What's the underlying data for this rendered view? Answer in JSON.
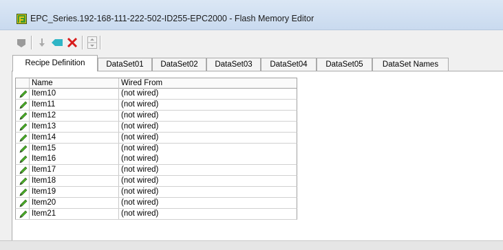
{
  "window": {
    "title": "EPC_Series.192-168-111-222-502-ID255-EPC2000 - Flash Memory Editor"
  },
  "toolbar": {
    "buttons": [
      {
        "icon": "tag-icon"
      },
      {
        "icon": "download-arrow-icon"
      },
      {
        "icon": "eraser-icon"
      },
      {
        "icon": "delete-icon"
      },
      {
        "icon": "spin-up-down-icon"
      }
    ]
  },
  "tabs": [
    "Recipe Definition",
    "DataSet01",
    "DataSet02",
    "DataSet03",
    "DataSet04",
    "DataSet05",
    "DataSet Names"
  ],
  "active_tab": "Recipe Definition",
  "grid": {
    "columns": [
      "Name",
      "Wired From"
    ],
    "rows": [
      {
        "name": "Item10",
        "wired": "(not wired)"
      },
      {
        "name": "Item11",
        "wired": "(not wired)"
      },
      {
        "name": "Item12",
        "wired": "(not wired)"
      },
      {
        "name": "Item13",
        "wired": "(not wired)"
      },
      {
        "name": "Item14",
        "wired": "(not wired)"
      },
      {
        "name": "Item15",
        "wired": "(not wired)"
      },
      {
        "name": "Item16",
        "wired": "(not wired)"
      },
      {
        "name": "Item17",
        "wired": "(not wired)"
      },
      {
        "name": "Item18",
        "wired": "(not wired)"
      },
      {
        "name": "Item19",
        "wired": "(not wired)"
      },
      {
        "name": "Item20",
        "wired": "(not wired)"
      },
      {
        "name": "Item21",
        "wired": "(not wired)"
      }
    ],
    "row_icon": "pencil-icon"
  },
  "colors": {
    "accent": "#c9daef",
    "pencil": "#4caf2a"
  }
}
